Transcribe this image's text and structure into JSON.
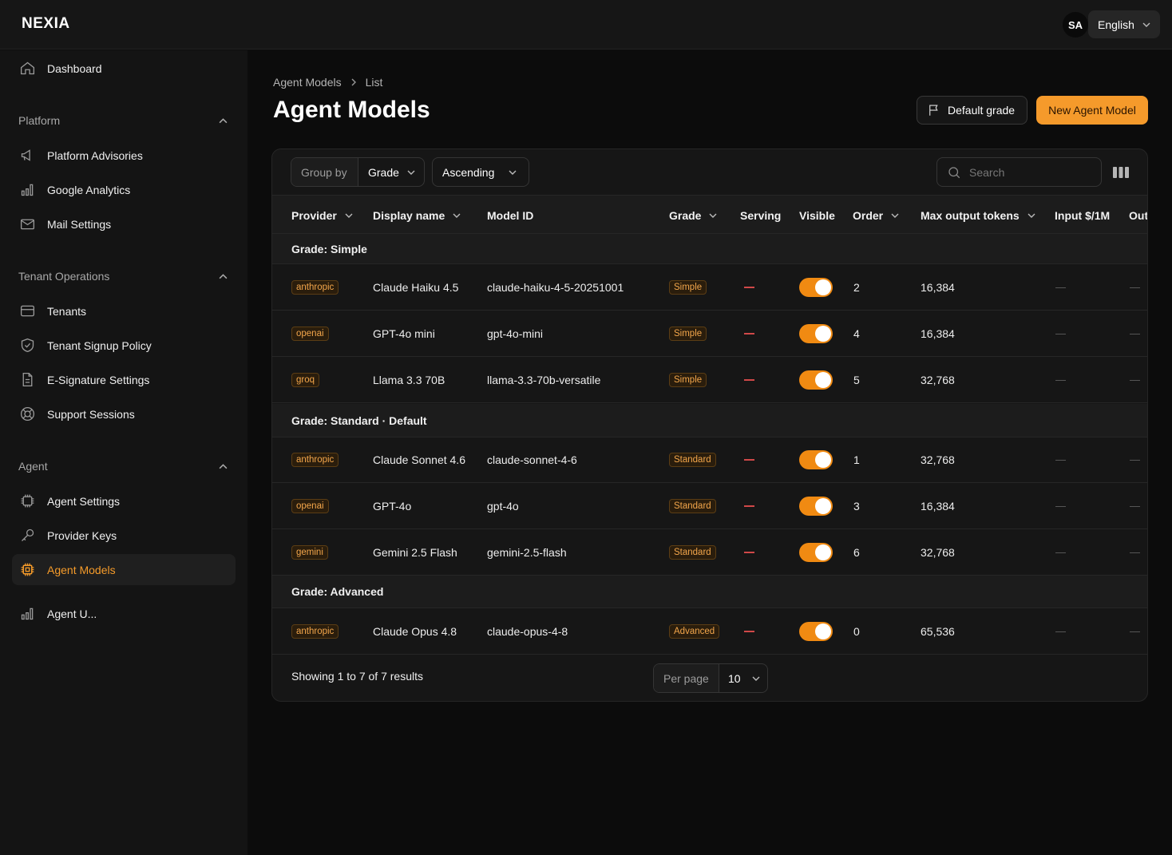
{
  "app": {
    "logo": "NEXIA",
    "user_initials": "SA",
    "language": "English"
  },
  "sidebar": {
    "dashboard": "Dashboard",
    "groups": {
      "platform": "Platform",
      "tenant_operations": "Tenant Operations",
      "agent": "Agent"
    },
    "items": {
      "platform_advisories": "Platform Advisories",
      "google_analytics": "Google Analytics",
      "mail_settings": "Mail Settings",
      "tenants": "Tenants",
      "tenant_signup_policy": "Tenant Signup Policy",
      "esignature_settings": "E-Signature Settings",
      "support_sessions": "Support Sessions",
      "agent_settings": "Agent Settings",
      "provider_keys": "Provider Keys",
      "agent_models": "Agent Models",
      "agent_usage_cut": "Agent U..."
    }
  },
  "breadcrumb": {
    "parent": "Agent Models",
    "current": "List"
  },
  "page": {
    "title": "Agent Models",
    "default_grade_button": "Default grade",
    "new_button": "New Agent Model"
  },
  "toolbar": {
    "group_by_label": "Group by",
    "group_by_value": "Grade",
    "sort_direction": "Ascending",
    "search_placeholder": "Search"
  },
  "table": {
    "columns": {
      "provider": "Provider",
      "display_name": "Display name",
      "model_id": "Model ID",
      "grade": "Grade",
      "serving": "Serving",
      "visible": "Visible",
      "order": "Order",
      "max_output_tokens": "Max output tokens",
      "input_price": "Input $/1M",
      "output_price_cut": "Out"
    },
    "groups": [
      {
        "label": "Grade: Simple"
      },
      {
        "label": "Grade: Standard · Default"
      },
      {
        "label": "Grade: Advanced"
      }
    ],
    "rows": [
      {
        "provider": "anthropic",
        "display_name": "Claude Haiku 4.5",
        "model_id": "claude-haiku-4-5-20251001",
        "grade": "Simple",
        "visible": true,
        "order": "2",
        "max_output_tokens": "16,384"
      },
      {
        "provider": "openai",
        "display_name": "GPT-4o mini",
        "model_id": "gpt-4o-mini",
        "grade": "Simple",
        "visible": true,
        "order": "4",
        "max_output_tokens": "16,384"
      },
      {
        "provider": "groq",
        "display_name": "Llama 3.3 70B",
        "model_id": "llama-3.3-70b-versatile",
        "grade": "Simple",
        "visible": true,
        "order": "5",
        "max_output_tokens": "32,768"
      },
      {
        "provider": "anthropic",
        "display_name": "Claude Sonnet 4.6",
        "model_id": "claude-sonnet-4-6",
        "grade": "Standard",
        "visible": true,
        "order": "1",
        "max_output_tokens": "32,768"
      },
      {
        "provider": "openai",
        "display_name": "GPT-4o",
        "model_id": "gpt-4o",
        "grade": "Standard",
        "visible": true,
        "order": "3",
        "max_output_tokens": "16,384"
      },
      {
        "provider": "gemini",
        "display_name": "Gemini 2.5 Flash",
        "model_id": "gemini-2.5-flash",
        "grade": "Standard",
        "visible": true,
        "order": "6",
        "max_output_tokens": "32,768"
      },
      {
        "provider": "anthropic",
        "display_name": "Claude Opus 4.8",
        "model_id": "claude-opus-4-8",
        "grade": "Advanced",
        "visible": true,
        "order": "0",
        "max_output_tokens": "65,536"
      }
    ]
  },
  "footer": {
    "results_text": "Showing 1 to 7 of 7 results",
    "per_page_label": "Per page",
    "per_page_value": "10"
  },
  "colors": {
    "accent": "#f59a2b",
    "toggle_on": "#f08a12",
    "serving_dash": "#d04848"
  }
}
